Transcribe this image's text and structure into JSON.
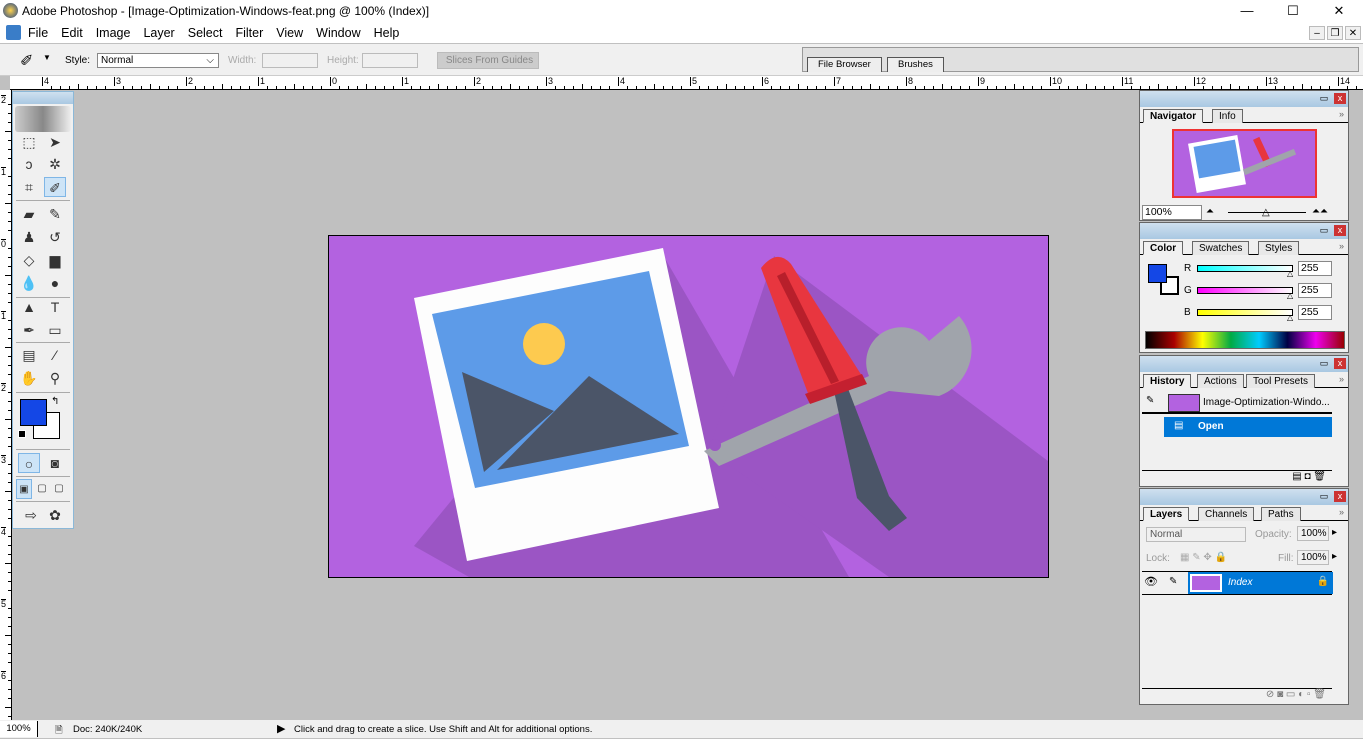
{
  "window": {
    "title": "Adobe Photoshop - [Image-Optimization-Windows-feat.png @ 100% (Index)]",
    "minimize": "—",
    "maximize": "☐",
    "close": "✕"
  },
  "menu": [
    "File",
    "Edit",
    "Image",
    "Layer",
    "Select",
    "Filter",
    "View",
    "Window",
    "Help"
  ],
  "options": {
    "style_label": "Style:",
    "style_value": "Normal",
    "width_label": "Width:",
    "height_label": "Height:",
    "slices_button": "Slices From Guides",
    "tool_icon": "slice-icon"
  },
  "palette_well": {
    "tabs": [
      "File Browser",
      "Brushes"
    ]
  },
  "rulers": {
    "top": [
      "4",
      "3",
      "2",
      "1",
      "0",
      "1",
      "2",
      "3",
      "4",
      "5",
      "6",
      "7",
      "8",
      "9",
      "10",
      "11",
      "12",
      "13",
      "14"
    ],
    "left": [
      "2",
      "1",
      "0",
      "1",
      "2",
      "3",
      "4",
      "5",
      "6"
    ]
  },
  "toolbox": {
    "tools": [
      {
        "name": "marquee",
        "glyph": "⬚"
      },
      {
        "name": "move",
        "glyph": "➤"
      },
      {
        "name": "lasso",
        "glyph": "ↄ"
      },
      {
        "name": "magic-wand",
        "glyph": "✲"
      },
      {
        "name": "crop",
        "glyph": "⌗"
      },
      {
        "name": "slice",
        "glyph": "✐",
        "selected": true
      },
      {
        "name": "healing-brush",
        "glyph": "▰"
      },
      {
        "name": "brush",
        "glyph": "✎"
      },
      {
        "name": "clone-stamp",
        "glyph": "♟"
      },
      {
        "name": "history-brush",
        "glyph": "↺"
      },
      {
        "name": "eraser",
        "glyph": "◇"
      },
      {
        "name": "gradient",
        "glyph": "▆"
      },
      {
        "name": "blur",
        "glyph": "💧"
      },
      {
        "name": "dodge",
        "glyph": "●"
      },
      {
        "name": "path-selection",
        "glyph": "▲"
      },
      {
        "name": "type",
        "glyph": "T"
      },
      {
        "name": "pen",
        "glyph": "✒"
      },
      {
        "name": "rectangle",
        "glyph": "▭"
      },
      {
        "name": "notes",
        "glyph": "▤"
      },
      {
        "name": "eyedropper",
        "glyph": "⁄"
      },
      {
        "name": "hand",
        "glyph": "✋"
      },
      {
        "name": "zoom",
        "glyph": "⚲"
      }
    ],
    "foreground": "#1447e6",
    "background": "#ffffff"
  },
  "navigator": {
    "tabs": [
      "Navigator",
      "Info"
    ],
    "zoom": "100%"
  },
  "color": {
    "tabs": [
      "Color",
      "Swatches",
      "Styles"
    ],
    "channels": [
      {
        "label": "R",
        "value": "255",
        "from": "#00ffff",
        "to": "#ffffff"
      },
      {
        "label": "G",
        "value": "255",
        "from": "#ff00ff",
        "to": "#ffffff"
      },
      {
        "label": "B",
        "value": "255",
        "from": "#ffff00",
        "to": "#ffffff"
      }
    ],
    "foreground": "#1447e6"
  },
  "history": {
    "tabs": [
      "History",
      "Actions",
      "Tool Presets"
    ],
    "snapshot": "Image-Optimization-Windo...",
    "items": [
      "Open"
    ]
  },
  "layers": {
    "tabs": [
      "Layers",
      "Channels",
      "Paths"
    ],
    "blend": "Normal",
    "opacity_label": "Opacity:",
    "opacity": "100%",
    "lock_label": "Lock:",
    "fill_label": "Fill:",
    "fill": "100%",
    "layer_name": "Index"
  },
  "status": {
    "zoom": "100%",
    "doc": "Doc: 240K/240K",
    "hint": "Click and drag to create a slice. Use Shift and Alt for additional options."
  },
  "colors": {
    "image_bg": "#b362e0",
    "shadow": "#9b55c4",
    "photo_blue": "#5d9be8",
    "sun": "#fdca4f",
    "mountain": "#4b5568",
    "handle_red": "#e8363f",
    "wrench": "#a0a4ab",
    "selection": "#0078d7"
  }
}
